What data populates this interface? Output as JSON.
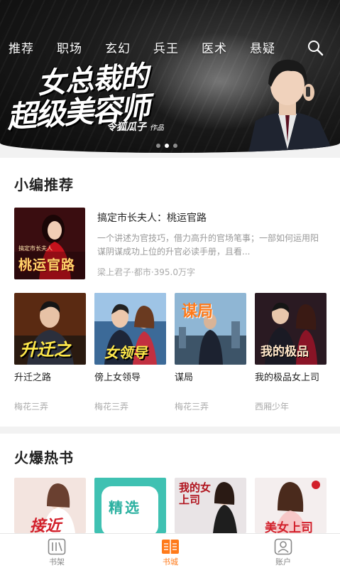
{
  "banner": {
    "tabs": [
      "推荐",
      "职场",
      "玄幻",
      "兵王",
      "医术",
      "悬疑"
    ],
    "title_line1": "女总裁的",
    "title_line2": "超级美容师",
    "author": "令狐瓜子",
    "author_suffix": "作品",
    "slide_count": 3,
    "active_slide": 2
  },
  "editor_pick": {
    "title": "小编推荐",
    "featured": {
      "name": "搞定市长夫人：桃运官路",
      "description": "一个讲述为官技巧，借力高升的官场笔事；一部如何运用阳谋阴谋成功上位的升官必读手册，且看...",
      "meta": "梁上君子·都市·395.0万字",
      "cover_text": "桃运官路",
      "cover_sub": "搞定市长夫人"
    },
    "books": [
      {
        "name": "升迁之路",
        "author": "梅花三弄",
        "cover_text": "升迁之路"
      },
      {
        "name": "傍上女领导",
        "author": "梅花三弄",
        "cover_text": "女领导"
      },
      {
        "name": "谋局",
        "author": "梅花三弄",
        "cover_text": "谋局"
      },
      {
        "name": "我的极品女上司",
        "author": "西厢少年",
        "cover_text": "我的极品"
      }
    ]
  },
  "hot": {
    "title": "火爆热书",
    "covers": [
      "接近",
      "精选",
      "我的女上司",
      "美女上司"
    ]
  },
  "tabbar": {
    "items": [
      "书架",
      "书城",
      "账户"
    ],
    "active": "书城"
  },
  "colors": {
    "accent": "#ff7a1a",
    "banner_bg": "#1b1b1b"
  }
}
